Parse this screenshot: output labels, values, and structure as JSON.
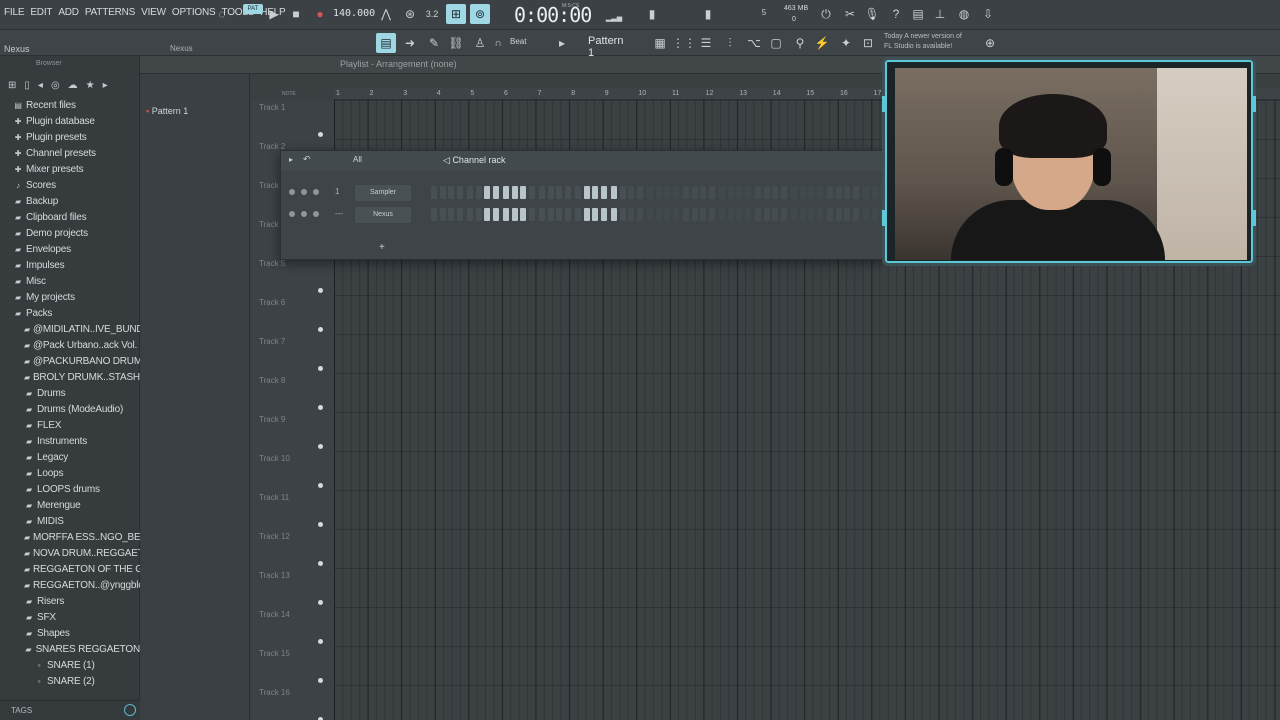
{
  "menu": [
    "FILE",
    "EDIT",
    "ADD",
    "PATTERNS",
    "VIEW",
    "OPTIONS",
    "TOOLS",
    "HELP"
  ],
  "transport": {
    "pat_badge": "PAT",
    "tempo": "140.000",
    "time": "0:00:00",
    "time_label": "M:S:CS",
    "memory": "463 MB",
    "memory_sub": "0",
    "counter": "5"
  },
  "hint_bar": {
    "plugin_name": "Nexus",
    "plugin_name_right": "Nexus"
  },
  "toolbar2": {
    "snap": "Beat",
    "pattern": "Pattern 1",
    "news_line1": "Today  A newer version of",
    "news_line2": "FL Studio is available!"
  },
  "browser": {
    "header": "Browser",
    "items": [
      {
        "label": "Recent files",
        "icon": "recent-icon"
      },
      {
        "label": "Plugin database",
        "icon": "plugin-icon"
      },
      {
        "label": "Plugin presets",
        "icon": "plugin-icon"
      },
      {
        "label": "Channel presets",
        "icon": "plugin-icon"
      },
      {
        "label": "Mixer presets",
        "icon": "plugin-icon"
      },
      {
        "label": "Scores",
        "icon": "note-icon"
      },
      {
        "label": "Backup",
        "icon": "folder-icon"
      },
      {
        "label": "Clipboard files",
        "icon": "folder-icon"
      },
      {
        "label": "Demo projects",
        "icon": "folder-icon"
      },
      {
        "label": "Envelopes",
        "icon": "folder-icon"
      },
      {
        "label": "Impulses",
        "icon": "folder-icon"
      },
      {
        "label": "Misc",
        "icon": "folder-icon"
      },
      {
        "label": "My projects",
        "icon": "folder-icon"
      },
      {
        "label": "Packs",
        "icon": "folder-icon"
      },
      {
        "label": "@MIDILATIN..IVE_BUNDLE",
        "icon": "folder-icon"
      },
      {
        "label": "@Pack Urbano..ack Vol. 03",
        "icon": "folder-icon"
      },
      {
        "label": "@PACKURBANO DRUMKIT",
        "icon": "folder-icon"
      },
      {
        "label": "BROLY DRUMK..STASH KIT)",
        "icon": "folder-icon"
      },
      {
        "label": "Drums",
        "icon": "folder-icon"
      },
      {
        "label": "Drums (ModeAudio)",
        "icon": "folder-icon"
      },
      {
        "label": "FLEX",
        "icon": "folder-icon"
      },
      {
        "label": "Instruments",
        "icon": "folder-icon"
      },
      {
        "label": "Legacy",
        "icon": "folder-icon"
      },
      {
        "label": "Loops",
        "icon": "folder-icon"
      },
      {
        "label": "LOOPS drums",
        "icon": "folder-icon"
      },
      {
        "label": "Merengue",
        "icon": "folder-icon"
      },
      {
        "label": "MIDIS",
        "icon": "folder-icon"
      },
      {
        "label": "MORFFA ESS..NGO_BEATS",
        "icon": "folder-icon"
      },
      {
        "label": "NOVA DRUM..REGGAETON",
        "icon": "folder-icon"
      },
      {
        "label": "REGGAETON OF THE GODS",
        "icon": "folder-icon"
      },
      {
        "label": "REGGAETON..@ynggblood",
        "icon": "folder-icon"
      },
      {
        "label": "Risers",
        "icon": "folder-icon"
      },
      {
        "label": "SFX",
        "icon": "folder-icon"
      },
      {
        "label": "Shapes",
        "icon": "folder-icon"
      },
      {
        "label": "SNARES REGGAETON",
        "icon": "folder-icon"
      },
      {
        "label": "SNARE (1)",
        "icon": "file-icon"
      },
      {
        "label": "SNARE (2)",
        "icon": "file-icon"
      }
    ],
    "footer": "TAGS"
  },
  "playlist": {
    "title": "Playlist - Arrangement",
    "title_suffix": "(none)",
    "pattern_item": "Pattern 1",
    "ruler": [
      "1",
      "2",
      "3",
      "4",
      "5",
      "6",
      "7",
      "8",
      "9",
      "10",
      "11",
      "12",
      "13",
      "14",
      "15",
      "16",
      "17"
    ],
    "tracks": [
      "Track 1",
      "Track 2",
      "Track 3",
      "Track 4",
      "Track 5",
      "Track 6",
      "Track 7",
      "Track 8",
      "Track 9",
      "Track 10",
      "Track 11",
      "Track 12",
      "Track 13",
      "Track 14",
      "Track 15",
      "Track 16"
    ]
  },
  "channel_rack": {
    "title": "Channel rack",
    "filter": "All",
    "channels": [
      {
        "num": "1",
        "name": "Sampler"
      },
      {
        "num": "---",
        "name": "Nexus"
      }
    ],
    "add_label": "+"
  },
  "colors": {
    "accent": "#5ec7d8",
    "background": "#3a3f42"
  }
}
